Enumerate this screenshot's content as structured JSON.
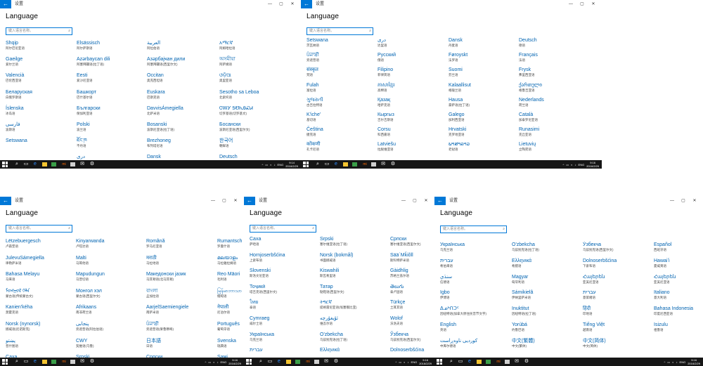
{
  "common": {
    "app_title": "设置",
    "back_glyph": "←",
    "heading": "Language",
    "search_placeholder": "键入语言名称。",
    "search_icon": "⌕",
    "ctrl_min": "—",
    "ctrl_max": "▢",
    "ctrl_close": "✕",
    "tray_lang": "ENG",
    "date": "2016/2/29",
    "tray_icons": [
      "^",
      "▭",
      "◐",
      "♪"
    ]
  },
  "windows": [
    {
      "time": "9:14",
      "columns": [
        [
          {
            "name": "Shqip",
            "sub": "阿尔巴尼亚语"
          },
          {
            "name": "Gaeilge",
            "sub": "爱尔兰语"
          },
          {
            "name": "Valencià",
            "sub": "巴伦西亚语"
          },
          {
            "name": "Беларуская",
            "sub": "白俄罗斯语"
          },
          {
            "name": "Íslenska",
            "sub": "冰岛语"
          },
          {
            "name": "فارسی",
            "sub": "波斯语"
          },
          {
            "name": "Setswana",
            "sub": ""
          }
        ],
        [
          {
            "name": "Elsässisch",
            "sub": "阿尔萨斯语"
          },
          {
            "name": "Azərbaycan dili",
            "sub": "阿塞拜疆语(拉丁语)"
          },
          {
            "name": "Eesti",
            "sub": "爱沙尼亚语"
          },
          {
            "name": "Башкорт",
            "sub": "巴什基尔语"
          },
          {
            "name": "Български",
            "sub": "保加利亚语"
          },
          {
            "name": "Polski",
            "sub": "波兰语"
          },
          {
            "name": "ཇོང་ཁ",
            "sub": "不丹语"
          },
          {
            "name": "دری",
            "sub": ""
          }
        ],
        [
          {
            "name": "العربية",
            "sub": "阿拉伯语"
          },
          {
            "name": "Азәрбајҹан дили",
            "sub": "阿塞拜疆语(西里尔文)"
          },
          {
            "name": "Occitan",
            "sub": "奥克西坦语"
          },
          {
            "name": "Euskara",
            "sub": "巴斯克语"
          },
          {
            "name": "DavvisÁmegiella",
            "sub": "北萨米语"
          },
          {
            "name": "Bosanski",
            "sub": "波斯尼亚语(拉丁语)"
          },
          {
            "name": "Brezhoneg",
            "sub": "布列塔尼语"
          },
          {
            "name": "Dansk",
            "sub": ""
          }
        ],
        [
          {
            "name": "አማርኛ",
            "sub": "阿姆哈拉语"
          },
          {
            "name": "অসমীয়া",
            "sub": "阿萨姆语"
          },
          {
            "name": "ଓଡ଼ିଆ",
            "sub": "奥里亚语"
          },
          {
            "name": "Sesotho sa Leboa",
            "sub": "北索托语"
          },
          {
            "name": "ᏣᎳᎩ ᎦᏬᏂᎯᏍᏗ",
            "sub": "切罗基语(切罗基文)"
          },
          {
            "name": "Босански",
            "sub": "波斯尼亚语(西里尔文)"
          },
          {
            "name": "한국어",
            "sub": "朝鲜语"
          },
          {
            "name": "Deutsch",
            "sub": ""
          }
        ]
      ]
    },
    {
      "time": "9:16",
      "columns": [
        [
          {
            "name": "Setswana",
            "sub": "茨瓦纳语"
          },
          {
            "name": "ਪੰਜਾਬੀ",
            "sub": "旁遮普语"
          },
          {
            "name": "संस्कृत",
            "sub": "梵语"
          },
          {
            "name": "Fulah",
            "sub": "富拉语"
          },
          {
            "name": "ગુજરાતી",
            "sub": "古吉拉特语"
          },
          {
            "name": "K'iche'",
            "sub": "基切语"
          },
          {
            "name": "Čeština",
            "sub": "捷克语"
          },
          {
            "name": "कोंकणी",
            "sub": "孔卡尼语"
          }
        ],
        [
          {
            "name": "دری",
            "sub": "达里语"
          },
          {
            "name": "Русский",
            "sub": "俄语"
          },
          {
            "name": "Filipino",
            "sub": "菲律宾语"
          },
          {
            "name": "ភាសាខ្មែរ",
            "sub": "高棉语"
          },
          {
            "name": "Қазақ",
            "sub": "哈萨克语"
          },
          {
            "name": "Кыргыз",
            "sub": "吉尔吉斯语"
          },
          {
            "name": "Corsu",
            "sub": "科西嘉语"
          },
          {
            "name": "Latviešu",
            "sub": "拉脱维亚语"
          }
        ],
        [
          {
            "name": "Dansk",
            "sub": "丹麦语"
          },
          {
            "name": "Føroyskt",
            "sub": "法罗语"
          },
          {
            "name": "Suomi",
            "sub": "芬兰语"
          },
          {
            "name": "Kalaallisut",
            "sub": "格陵兰语"
          },
          {
            "name": "Hausa",
            "sub": "豪萨语(拉丁语)"
          },
          {
            "name": "Galego",
            "sub": "加利西亚语"
          },
          {
            "name": "Hrvatski",
            "sub": "克罗地亚语"
          },
          {
            "name": "ພາສາລາວ",
            "sub": "老挝语"
          }
        ],
        [
          {
            "name": "Deutsch",
            "sub": "德语"
          },
          {
            "name": "Français",
            "sub": "法语"
          },
          {
            "name": "Frysk",
            "sub": "弗里西亚语"
          },
          {
            "name": "ქართული",
            "sub": "格鲁吉亚语"
          },
          {
            "name": "Nederlands",
            "sub": "荷兰语"
          },
          {
            "name": "Català",
            "sub": "加泰罗尼亚语"
          },
          {
            "name": "Runasimi",
            "sub": "克丘亚语"
          },
          {
            "name": "Lietuvių",
            "sub": "立陶宛语"
          }
        ]
      ]
    },
    {
      "time": "9:16",
      "columns": [
        [
          {
            "name": "Lëtzebuergesch",
            "sub": "卢森堡语"
          },
          {
            "name": "JulevuSámegiella",
            "sub": "律勒萨米语"
          },
          {
            "name": "Bahasa Melayu",
            "sub": "马来语"
          },
          {
            "name": "ᠮᠣᠩᠭᠣᠯ ᠬᠡᠯᠡ",
            "sub": "蒙古语(传统蒙古文)"
          },
          {
            "name": "Kanien'kéha",
            "sub": "莫霍克语"
          },
          {
            "name": "Norsk (nynorsk)",
            "sub": "挪威语(尼诺斯克)"
          },
          {
            "name": "پښتو",
            "sub": "普什图语"
          },
          {
            "name": "Саха",
            "sub": ""
          }
        ],
        [
          {
            "name": "Kinyarwanda",
            "sub": "卢旺达语"
          },
          {
            "name": "Malti",
            "sub": "马耳他语"
          },
          {
            "name": "Mapudungun",
            "sub": "马普切语"
          },
          {
            "name": "Монгол хэл",
            "sub": "蒙古语(西里尔文)"
          },
          {
            "name": "Afrikaans",
            "sub": "南非荷兰语"
          },
          {
            "name": "پنجابی",
            "sub": "旁遮普语(阿拉伯语)"
          },
          {
            "name": "CWY",
            "sub": "契维语(乌鲁)"
          },
          {
            "name": "Srpski",
            "sub": ""
          }
        ],
        [
          {
            "name": "Română",
            "sub": "罗马尼亚语"
          },
          {
            "name": "मराठी",
            "sub": "马拉地语"
          },
          {
            "name": "Македонски јазик",
            "sub": "马其顿语(北马其顿)"
          },
          {
            "name": "বাংলা",
            "sub": "孟加拉语"
          },
          {
            "name": "AarjelSaemiengiele",
            "sub": "南萨米语"
          },
          {
            "name": "ਪੰਜਾਬੀ",
            "sub": "旁遮普语(果鲁穆奇)"
          },
          {
            "name": "日本語",
            "sub": "日语"
          },
          {
            "name": "Српски",
            "sub": ""
          }
        ],
        [
          {
            "name": "Rumantsch",
            "sub": "罗曼什语"
          },
          {
            "name": "മലയാളം",
            "sub": "马拉雅拉姆语"
          },
          {
            "name": "Reo Māori",
            "sub": "毛利语"
          },
          {
            "name": "မြန်မာဘာသာ",
            "sub": "缅甸语"
          },
          {
            "name": "नेपाली",
            "sub": "尼泊尔语"
          },
          {
            "name": "Português",
            "sub": "葡萄牙语"
          },
          {
            "name": "Svenska",
            "sub": "瑞典语"
          },
          {
            "name": "Saмi",
            "sub": ""
          }
        ]
      ]
    },
    {
      "time": "9:16",
      "columns": [
        [
          {
            "name": "Caxa",
            "sub": "萨哈语"
          },
          {
            "name": "Hornjoserbšćina",
            "sub": "上索布语"
          },
          {
            "name": "Slovenski",
            "sub": "斯洛文尼亚语"
          },
          {
            "name": "Тоҷикӣ",
            "sub": "塔吉克语(西里尔文)"
          },
          {
            "name": "ไทย",
            "sub": "泰语"
          },
          {
            "name": "Cymraeg",
            "sub": "威尔士语"
          },
          {
            "name": "Українська",
            "sub": "乌克兰语"
          },
          {
            "name": "עברית",
            "sub": ""
          }
        ],
        [
          {
            "name": "Srpski",
            "sub": "塞尔维亚语(拉丁语)"
          },
          {
            "name": "Norsk (bokmål)",
            "sub": "书面挪威语"
          },
          {
            "name": "Kiswahili",
            "sub": "斯瓦希里语"
          },
          {
            "name": "Татар",
            "sub": "鞑靼语(西里尔文)"
          },
          {
            "name": "ትግርኛ",
            "sub": "提格雷尼亚语(埃塞俄比亚)"
          },
          {
            "name": "ئۇيغۇرچە",
            "sub": "维吾尔语"
          },
          {
            "name": "O'zbekcha",
            "sub": "乌兹别克语(拉丁语)"
          },
          {
            "name": "Ελληνικά",
            "sub": ""
          }
        ],
        [
          {
            "name": "Српски",
            "sub": "塞尔维亚语(西里尔文)"
          },
          {
            "name": "Sää´Mǩiõll",
            "sub": "斯科特萨米语"
          },
          {
            "name": "Gàidhlig",
            "sub": "苏格兰盖尔语"
          },
          {
            "name": "తెలుగు",
            "sub": "泰卢固语"
          },
          {
            "name": "Türkçe",
            "sub": "土耳其语"
          },
          {
            "name": "Wolof",
            "sub": "沃洛夫语"
          },
          {
            "name": "Ўзбекча",
            "sub": "乌兹别克语(西里尔文)"
          },
          {
            "name": "Dolnoserbšćina",
            "sub": ""
          }
        ]
      ]
    },
    {
      "time": "9:16",
      "columns": [
        [
          {
            "name": "Українська",
            "sub": "乌克兰语"
          },
          {
            "name": "עברית",
            "sub": "希伯来语"
          },
          {
            "name": "سنڌي",
            "sub": "信德语"
          },
          {
            "name": "Igbo",
            "sub": "伊博语"
          },
          {
            "name": "ᐃᓄᒃᑎᑐᑦ",
            "sub": "因纽特语(加拿大原住民音节文字)"
          },
          {
            "name": "English",
            "sub": "英语"
          },
          {
            "name": "كوردیی ناوەڕاست",
            "sub": "中库尔德语"
          }
        ],
        [
          {
            "name": "O'zbekcha",
            "sub": "乌兹别克语(拉丁语)"
          },
          {
            "name": "Ελληνικά",
            "sub": "希腊语"
          },
          {
            "name": "Magyar",
            "sub": "匈牙利语"
          },
          {
            "name": "Sámikielâ",
            "sub": "伊纳里萨米语"
          },
          {
            "name": "Inuktitut",
            "sub": "因纽特语(拉丁语)"
          },
          {
            "name": "Yorùbá",
            "sub": "约鲁巴语"
          },
          {
            "name": "中文(繁體)",
            "sub": "中文(繁体)"
          }
        ],
        [
          {
            "name": "Ўзбекча",
            "sub": "乌兹别克语(西里尔文)"
          },
          {
            "name": "Dolnoserbšćina",
            "sub": "下索布语"
          },
          {
            "name": "Հայերեն",
            "sub": "亚美尼亚语"
          },
          {
            "name": "עברית",
            "sub": "意第绪语"
          },
          {
            "name": "हिंदी",
            "sub": "印地语"
          },
          {
            "name": "Tiếng Việt",
            "sub": "越南语"
          },
          {
            "name": "中文(简体)",
            "sub": "中文(简体)"
          }
        ],
        [
          {
            "name": "Español",
            "sub": "西班牙语"
          },
          {
            "name": "Hawaiʻi",
            "sub": "夏威夷语"
          },
          {
            "name": "Հայերեն",
            "sub": "亚美尼亚语"
          },
          {
            "name": "Italiano",
            "sub": "意大利语"
          },
          {
            "name": "Bahasa Indonesia",
            "sub": "印度尼西亚语"
          },
          {
            "name": "Isizulu",
            "sub": "祖鲁语"
          }
        ]
      ]
    }
  ]
}
